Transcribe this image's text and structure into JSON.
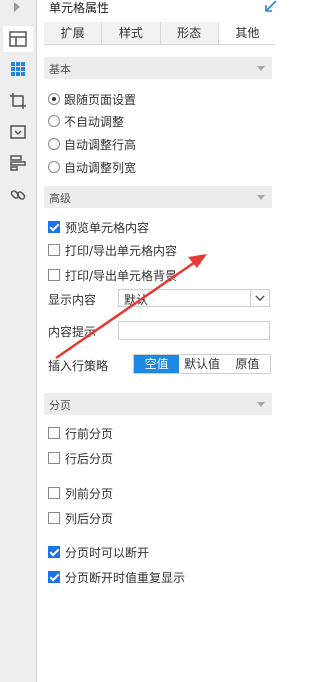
{
  "panel": {
    "title": "单元格属性"
  },
  "tabs": [
    {
      "label": "扩展",
      "active": false
    },
    {
      "label": "样式",
      "active": false
    },
    {
      "label": "形态",
      "active": false
    },
    {
      "label": "其他",
      "active": true
    }
  ],
  "left_toolbar": {
    "icons": [
      "expand-icon",
      "cell-layout-icon",
      "grid-icon",
      "crop-icon",
      "widget-icon",
      "list-icon",
      "link-icon"
    ]
  },
  "basic": {
    "header": "基本",
    "radios": [
      {
        "label": "跟随页面设置",
        "checked": true
      },
      {
        "label": "不自动调整",
        "checked": false
      },
      {
        "label": "自动调整行高",
        "checked": false
      },
      {
        "label": "自动调整列宽",
        "checked": false
      }
    ]
  },
  "advanced": {
    "header": "高级",
    "checkboxes": [
      {
        "label": "预览单元格内容",
        "checked": true
      },
      {
        "label": "打印/导出单元格内容",
        "checked": false
      },
      {
        "label": "打印/导出单元格背景",
        "checked": false
      }
    ],
    "display_label": "显示内容",
    "display_value": "默认",
    "tooltip_label": "内容提示",
    "tooltip_value": "",
    "insert_label": "插入行策略",
    "insert_options": [
      "空值",
      "默认值",
      "原值"
    ],
    "insert_selected": "空值"
  },
  "pagination": {
    "header": "分页",
    "checkboxes": [
      {
        "label": "行前分页",
        "checked": false
      },
      {
        "label": "行后分页",
        "checked": false
      },
      {
        "label": "列前分页",
        "checked": false
      },
      {
        "label": "列后分页",
        "checked": false
      },
      {
        "label": "分页时可以断开",
        "checked": true
      },
      {
        "label": "分页断开时值重复显示",
        "checked": true
      }
    ]
  },
  "colors": {
    "accent": "#1e88e5",
    "annotation": "#e53935",
    "header_bg": "#ededed"
  }
}
